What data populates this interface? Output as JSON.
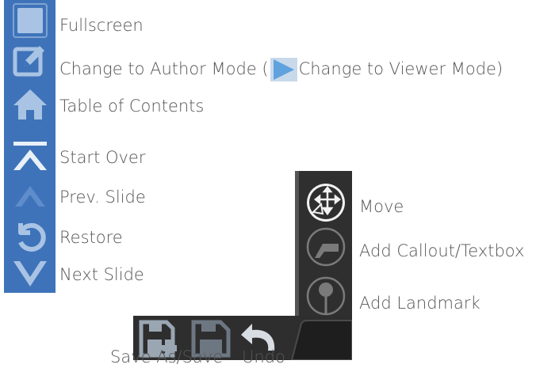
{
  "legend": {
    "fullscreen": "Fullscreen",
    "author_mode_prefix": "Change to Author Mode (",
    "viewer_mode_suffix": "Change to Viewer Mode)",
    "toc": "Table of Contents",
    "start_over": "Start Over",
    "prev_slide": "Prev. Slide",
    "restore": "Restore",
    "next_slide": "Next Slide",
    "move": "Move",
    "add_callout": "Add Callout/Textbox",
    "add_landmark": "Add Landmark",
    "save": "Save As/Save",
    "undo": "Undo"
  },
  "colors": {
    "sidebar_bg": "#3e73b9",
    "icon_light": "#a9c3e4",
    "icon_white": "#e9f0f8",
    "dark_panel": "#2f2f2f",
    "viewer_triangle": "#5fa2dd"
  },
  "icons": [
    "fullscreen-icon",
    "edit-icon",
    "home-icon",
    "start-over-icon",
    "prev-slide-icon",
    "restore-icon",
    "next-slide-icon",
    "move-icon",
    "callout-icon",
    "landmark-icon",
    "save-as-icon",
    "save-icon",
    "undo-icon"
  ]
}
